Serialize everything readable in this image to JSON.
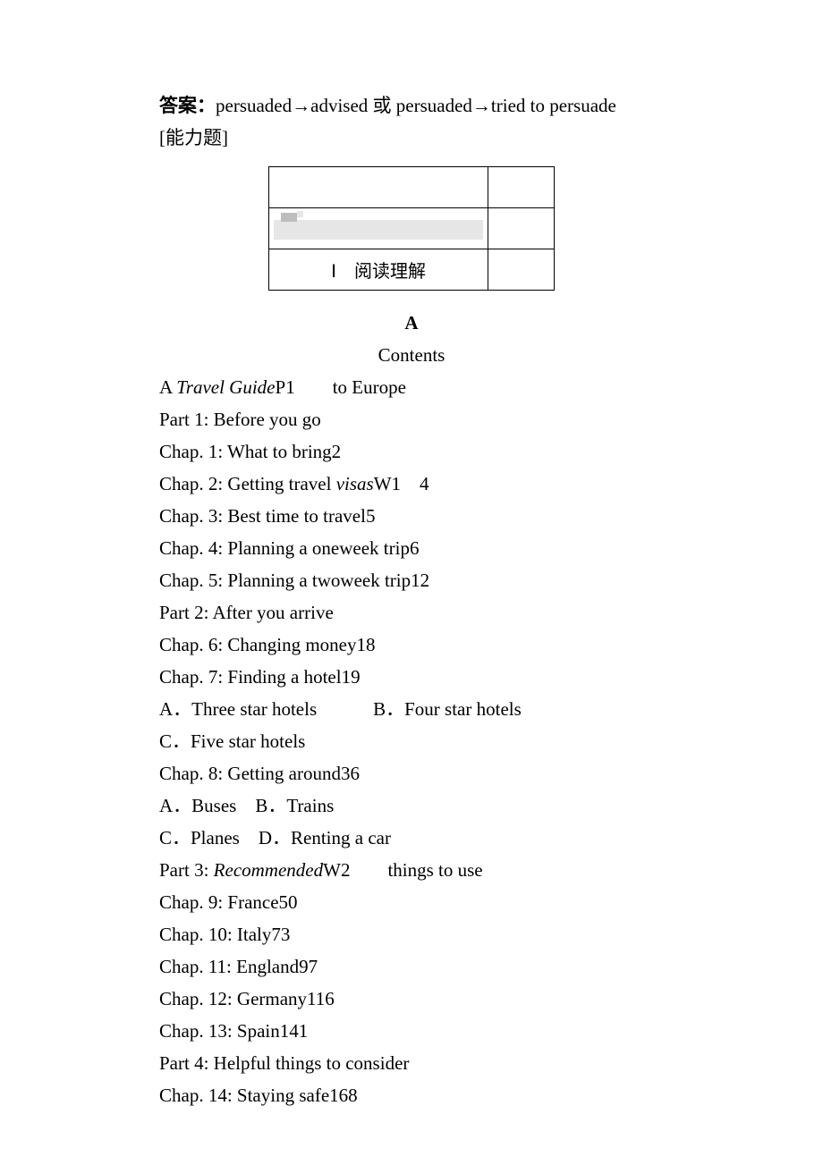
{
  "answer_line": {
    "label": "答案：",
    "text": "persuaded→advised 或 persuaded→tried to persuade"
  },
  "ability": "[能力题]",
  "table": {
    "reading_label": "Ⅰ　阅读理解"
  },
  "heading_a": "A",
  "heading_contents": "Contents",
  "lines": {
    "l1_a": "A ",
    "l1_b": "Travel Guide",
    "l1_c": "P1　　to Europe",
    "l2": "Part 1: Before you go",
    "l3": "Chap. 1: What to bring2",
    "l4_a": "Chap. 2: Getting travel ",
    "l4_b": "visas",
    "l4_c": "W1　4",
    "l5": "Chap. 3: Best time to travel5",
    "l6": "Chap. 4: Planning a one­week trip6",
    "l7": "Chap. 5: Planning a two­week trip12",
    "l8": "Part 2: After you arrive",
    "l9": "Chap. 6: Changing money18",
    "l10": "Chap. 7: Finding a hotel19",
    "l11": "A．Three star hotels　　　B．Four star hotels",
    "l12": "C．Five star hotels",
    "l13": "Chap. 8: Getting around36",
    "l14": "A．Buses　B．Trains",
    "l15": "C．Planes　D．Renting a car",
    "l16_a": "Part 3: ",
    "l16_b": "Recommended",
    "l16_c": "W2　　things to use",
    "l17": "Chap. 9: France50",
    "l18": "Chap. 10: Italy73",
    "l19": "Chap. 11: England97",
    "l20": "Chap. 12: Germany116",
    "l21": "Chap. 13: Spain141",
    "l22": "Part 4: Helpful things to consider",
    "l23": "Chap. 14: Staying safe168"
  }
}
